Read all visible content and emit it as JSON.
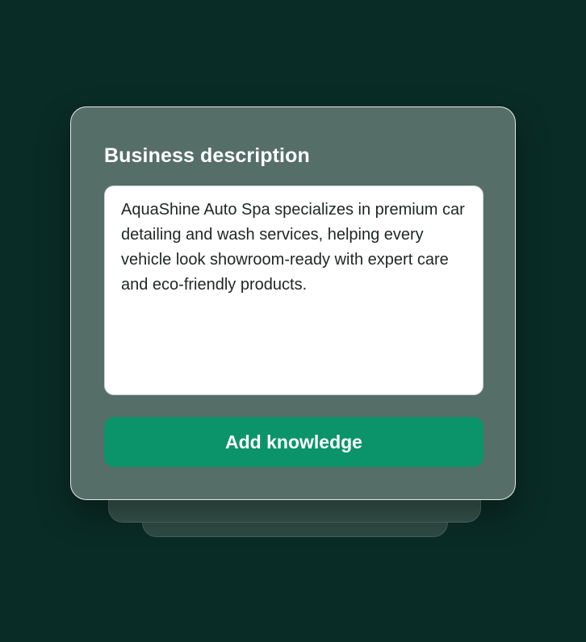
{
  "card": {
    "title": "Business description",
    "description_text": "AquaShine Auto Spa specializes in premium car detailing and wash services, helping every vehicle look showroom-ready with expert care and eco-friendly products.",
    "button_label": "Add knowledge"
  },
  "colors": {
    "background": "#0a2c26",
    "card": "#566e68",
    "button": "#0b9469",
    "text_box": "#ffffff"
  }
}
